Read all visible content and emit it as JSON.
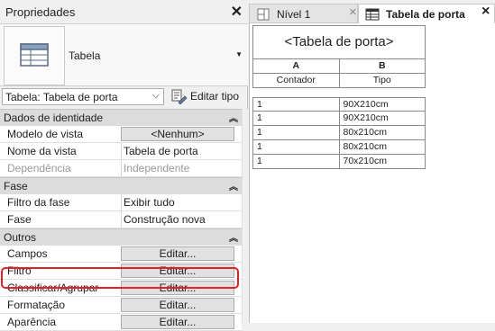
{
  "properties": {
    "title": "Propriedades",
    "type_name": "Tabela",
    "selector_value": "Tabela: Tabela de porta",
    "edit_type_label": "Editar tipo",
    "sections": {
      "identity": "Dados de identidade",
      "phase": "Fase",
      "others": "Outros"
    },
    "identity_rows": [
      {
        "label": "Modelo de vista",
        "value": "<Nenhum>"
      },
      {
        "label": "Nome da vista",
        "value": "Tabela de porta"
      },
      {
        "label": "Dependência",
        "value": "Independente"
      }
    ],
    "phase_rows": [
      {
        "label": "Filtro da fase",
        "value": "Exibir tudo"
      },
      {
        "label": "Fase",
        "value": "Construção nova"
      }
    ],
    "other_rows": [
      {
        "label": "Campos",
        "value": "Editar..."
      },
      {
        "label": "Filtro",
        "value": "Editar..."
      },
      {
        "label": "Classificar/Agrupar",
        "value": "Editar..."
      },
      {
        "label": "Formatação",
        "value": "Editar..."
      },
      {
        "label": "Aparência",
        "value": "Editar..."
      }
    ]
  },
  "tabs": [
    {
      "label": "Nível 1",
      "active": false
    },
    {
      "label": "Tabela de porta",
      "active": true
    }
  ],
  "schedule": {
    "title": "<Tabela de porta>",
    "col_letters": [
      "A",
      "B"
    ],
    "col_names": [
      "Contador",
      "Tipo"
    ],
    "rows": [
      [
        "1",
        "90X210cm"
      ],
      [
        "1",
        "90X210cm"
      ],
      [
        "1",
        "80x210cm"
      ],
      [
        "1",
        "80x210cm"
      ],
      [
        "1",
        "70x210cm"
      ]
    ]
  },
  "colors": {
    "highlight": "#e0202a"
  }
}
